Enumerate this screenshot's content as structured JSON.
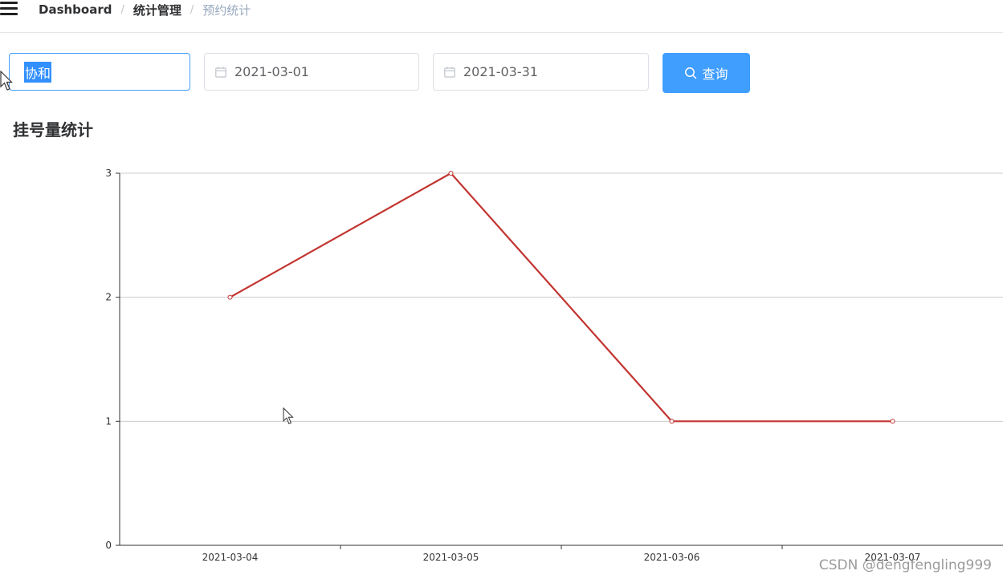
{
  "breadcrumb": {
    "items": [
      "Dashboard",
      "统计管理",
      "预约统计"
    ]
  },
  "filters": {
    "hospital_value": "协和",
    "start_date": "2021-03-01",
    "end_date": "2021-03-31",
    "query_label": "查询"
  },
  "section_title": "挂号量统计",
  "watermark": "CSDN @dengfengling999",
  "colors": {
    "primary": "#409eff",
    "line": "#c23531",
    "selection": "#3390ff"
  },
  "chart_data": {
    "type": "line",
    "categories": [
      "2021-03-04",
      "2021-03-05",
      "2021-03-06",
      "2021-03-07"
    ],
    "series": [
      {
        "values": [
          2,
          3,
          1,
          1
        ]
      }
    ],
    "ylim": [
      0,
      3
    ],
    "yticks": [
      0,
      1,
      2,
      3
    ],
    "grid": true
  }
}
